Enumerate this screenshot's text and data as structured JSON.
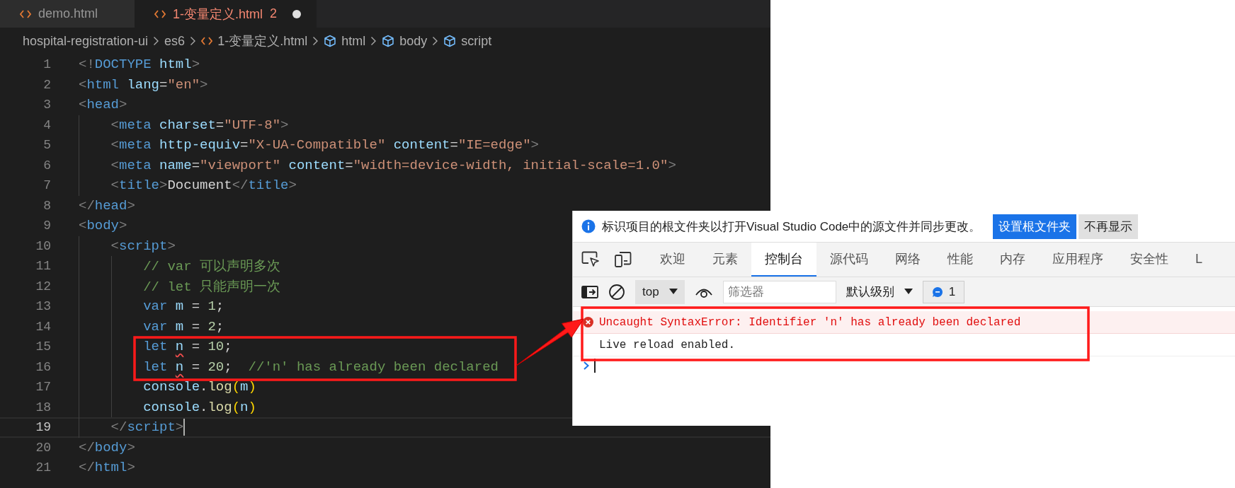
{
  "editor": {
    "tabs": [
      {
        "label": "demo.html",
        "selected": false,
        "error": false,
        "modified": false
      },
      {
        "label": "1-变量定义.html",
        "selected": true,
        "error": true,
        "problems": "2",
        "modified": true
      }
    ],
    "breadcrumb": [
      {
        "label": "hospital-registration-ui",
        "kind": "folder"
      },
      {
        "label": "es6",
        "kind": "folder"
      },
      {
        "label": "1-变量定义.html",
        "kind": "file"
      },
      {
        "label": "html",
        "kind": "element"
      },
      {
        "label": "body",
        "kind": "element"
      },
      {
        "label": "script",
        "kind": "element"
      }
    ],
    "lines": [
      {
        "number": "1",
        "current": false,
        "tokens": [
          {
            "kind": "p",
            "text": "<!"
          },
          {
            "kind": "tag",
            "text": "DOCTYPE"
          },
          {
            "kind": "attr",
            "text": " html"
          },
          {
            "kind": "p",
            "text": ">"
          }
        ]
      },
      {
        "number": "2",
        "current": false,
        "tokens": [
          {
            "kind": "p",
            "text": "<"
          },
          {
            "kind": "tag",
            "text": "html"
          },
          {
            "kind": "attr",
            "text": " lang"
          },
          {
            "kind": "txt",
            "text": "="
          },
          {
            "kind": "str",
            "text": "\"en\""
          },
          {
            "kind": "p",
            "text": ">"
          }
        ]
      },
      {
        "number": "3",
        "current": false,
        "tokens": [
          {
            "kind": "p",
            "text": "<"
          },
          {
            "kind": "tag",
            "text": "head"
          },
          {
            "kind": "p",
            "text": ">"
          }
        ]
      },
      {
        "number": "4",
        "current": false,
        "tokens": [
          {
            "kind": "p",
            "text": "    <"
          },
          {
            "kind": "tag",
            "text": "meta"
          },
          {
            "kind": "attr",
            "text": " charset"
          },
          {
            "kind": "txt",
            "text": "="
          },
          {
            "kind": "str",
            "text": "\"UTF-8\""
          },
          {
            "kind": "p",
            "text": ">"
          }
        ]
      },
      {
        "number": "5",
        "current": false,
        "tokens": [
          {
            "kind": "p",
            "text": "    <"
          },
          {
            "kind": "tag",
            "text": "meta"
          },
          {
            "kind": "attr",
            "text": " http-equiv"
          },
          {
            "kind": "txt",
            "text": "="
          },
          {
            "kind": "str",
            "text": "\"X-UA-Compatible\""
          },
          {
            "kind": "attr",
            "text": " content"
          },
          {
            "kind": "txt",
            "text": "="
          },
          {
            "kind": "str",
            "text": "\"IE=edge\""
          },
          {
            "kind": "p",
            "text": ">"
          }
        ]
      },
      {
        "number": "6",
        "current": false,
        "tokens": [
          {
            "kind": "p",
            "text": "    <"
          },
          {
            "kind": "tag",
            "text": "meta"
          },
          {
            "kind": "attr",
            "text": " name"
          },
          {
            "kind": "txt",
            "text": "="
          },
          {
            "kind": "str",
            "text": "\"viewport\""
          },
          {
            "kind": "attr",
            "text": " content"
          },
          {
            "kind": "txt",
            "text": "="
          },
          {
            "kind": "str",
            "text": "\"width=device-width, initial-scale=1.0\""
          },
          {
            "kind": "p",
            "text": ">"
          }
        ]
      },
      {
        "number": "7",
        "current": false,
        "tokens": [
          {
            "kind": "p",
            "text": "    <"
          },
          {
            "kind": "tag",
            "text": "title"
          },
          {
            "kind": "p",
            "text": ">"
          },
          {
            "kind": "txt",
            "text": "Document"
          },
          {
            "kind": "p",
            "text": "</"
          },
          {
            "kind": "tag",
            "text": "title"
          },
          {
            "kind": "p",
            "text": ">"
          }
        ]
      },
      {
        "number": "8",
        "current": false,
        "tokens": [
          {
            "kind": "p",
            "text": "</"
          },
          {
            "kind": "tag",
            "text": "head"
          },
          {
            "kind": "p",
            "text": ">"
          }
        ]
      },
      {
        "number": "9",
        "current": false,
        "tokens": [
          {
            "kind": "p",
            "text": "<"
          },
          {
            "kind": "tag",
            "text": "body"
          },
          {
            "kind": "p",
            "text": ">"
          }
        ]
      },
      {
        "number": "10",
        "current": false,
        "tokens": [
          {
            "kind": "p",
            "text": "    <"
          },
          {
            "kind": "tag",
            "text": "script"
          },
          {
            "kind": "p",
            "text": ">"
          }
        ]
      },
      {
        "number": "11",
        "current": false,
        "tokens": [
          {
            "kind": "com",
            "text": "        // var 可以声明多次"
          }
        ]
      },
      {
        "number": "12",
        "current": false,
        "tokens": [
          {
            "kind": "com",
            "text": "        // let 只能声明一次"
          }
        ]
      },
      {
        "number": "13",
        "current": false,
        "tokens": [
          {
            "kind": "kw",
            "text": "        var"
          },
          {
            "kind": "var",
            "text": " m"
          },
          {
            "kind": "txt",
            "text": " = "
          },
          {
            "kind": "num",
            "text": "1"
          },
          {
            "kind": "txt",
            "text": ";"
          }
        ]
      },
      {
        "number": "14",
        "current": false,
        "tokens": [
          {
            "kind": "kw",
            "text": "        var"
          },
          {
            "kind": "var",
            "text": " m"
          },
          {
            "kind": "txt",
            "text": " = "
          },
          {
            "kind": "num",
            "text": "2"
          },
          {
            "kind": "txt",
            "text": ";"
          }
        ]
      },
      {
        "number": "15",
        "current": false,
        "tokens": [
          {
            "kind": "kw",
            "text": "        let "
          },
          {
            "kind": "err",
            "text": "n"
          },
          {
            "kind": "txt",
            "text": " = "
          },
          {
            "kind": "num",
            "text": "10"
          },
          {
            "kind": "txt",
            "text": ";"
          }
        ]
      },
      {
        "number": "16",
        "current": false,
        "tokens": [
          {
            "kind": "kw",
            "text": "        let "
          },
          {
            "kind": "err",
            "text": "n"
          },
          {
            "kind": "txt",
            "text": " = "
          },
          {
            "kind": "num",
            "text": "20"
          },
          {
            "kind": "txt",
            "text": ";  "
          },
          {
            "kind": "com",
            "text": "//'n' has already been declared"
          }
        ]
      },
      {
        "number": "17",
        "current": false,
        "tokens": [
          {
            "kind": "var",
            "text": "        console"
          },
          {
            "kind": "txt",
            "text": "."
          },
          {
            "kind": "fn",
            "text": "log"
          },
          {
            "kind": "paren",
            "text": "("
          },
          {
            "kind": "var",
            "text": "m"
          },
          {
            "kind": "paren",
            "text": ")"
          }
        ]
      },
      {
        "number": "18",
        "current": false,
        "tokens": [
          {
            "kind": "var",
            "text": "        console"
          },
          {
            "kind": "txt",
            "text": "."
          },
          {
            "kind": "fn",
            "text": "log"
          },
          {
            "kind": "paren",
            "text": "("
          },
          {
            "kind": "var",
            "text": "n"
          },
          {
            "kind": "paren",
            "text": ")"
          }
        ]
      },
      {
        "number": "19",
        "current": true,
        "tokens": [
          {
            "kind": "p",
            "text": "    </"
          },
          {
            "kind": "tag",
            "text": "script"
          },
          {
            "kind": "p",
            "text": ">"
          }
        ]
      },
      {
        "number": "20",
        "current": false,
        "tokens": [
          {
            "kind": "p",
            "text": "</"
          },
          {
            "kind": "tag",
            "text": "body"
          },
          {
            "kind": "p",
            "text": ">"
          }
        ]
      },
      {
        "number": "21",
        "current": false,
        "tokens": [
          {
            "kind": "p",
            "text": "</"
          },
          {
            "kind": "tag",
            "text": "html"
          },
          {
            "kind": "p",
            "text": ">"
          }
        ]
      }
    ]
  },
  "devtools": {
    "infobar": {
      "message": "标识项目的根文件夹以打开Visual Studio Code中的源文件并同步更改。",
      "buttons": [
        {
          "label": "设置根文件夹",
          "kind": "primary"
        },
        {
          "label": "不再显示",
          "kind": "secondary"
        }
      ]
    },
    "tabs": [
      {
        "label": "欢迎",
        "selected": false
      },
      {
        "label": "元素",
        "selected": false
      },
      {
        "label": "控制台",
        "selected": true
      },
      {
        "label": "源代码",
        "selected": false
      },
      {
        "label": "网络",
        "selected": false
      },
      {
        "label": "性能",
        "selected": false
      },
      {
        "label": "内存",
        "selected": false
      },
      {
        "label": "应用程序",
        "selected": false
      },
      {
        "label": "安全性",
        "selected": false
      },
      {
        "label": "L",
        "selected": false
      }
    ],
    "toolbar": {
      "context": "top",
      "filter_placeholder": "筛选器",
      "level": "默认级别",
      "message_count": "1"
    },
    "messages": [
      {
        "kind": "error",
        "text": "Uncaught SyntaxError: Identifier 'n' has already been declared"
      },
      {
        "kind": "log",
        "text": "Live reload enabled."
      }
    ]
  }
}
